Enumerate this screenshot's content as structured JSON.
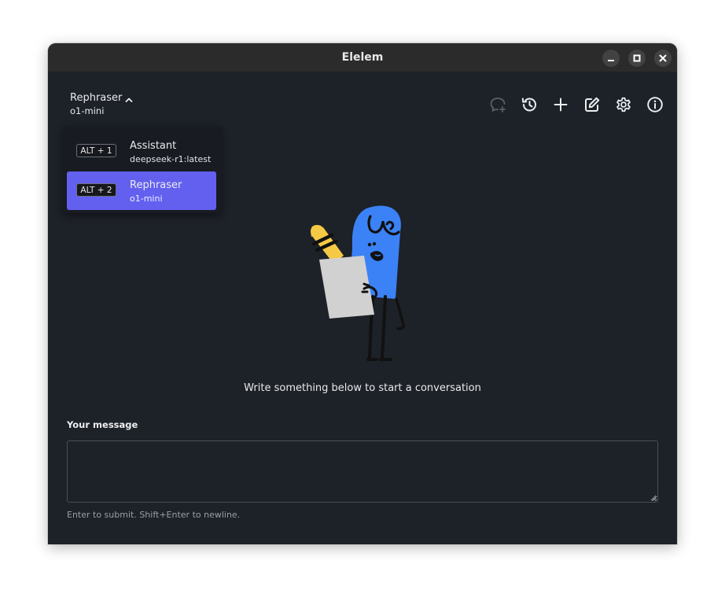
{
  "window": {
    "title": "Elelem"
  },
  "selector": {
    "name": "Rephraser",
    "model": "o1-mini"
  },
  "toolbar": {
    "icons": [
      "new-chat-icon",
      "history-icon",
      "plus-icon",
      "edit-icon",
      "gear-icon",
      "info-icon"
    ]
  },
  "dropdown": {
    "items": [
      {
        "shortcut": "ALT + 1",
        "label": "Assistant",
        "model": "deepseek-r1:latest",
        "active": false
      },
      {
        "shortcut": "ALT + 2",
        "label": "Rephraser",
        "model": "o1-mini",
        "active": true
      }
    ]
  },
  "empty_state": {
    "text": "Write something below to start a conversation"
  },
  "composer": {
    "label": "Your message",
    "value": "",
    "placeholder": "",
    "hint": "Enter to submit. Shift+Enter to newline."
  },
  "colors": {
    "background": "#1d2128",
    "accent": "#6360f0",
    "titlebar": "#2b2b2b"
  }
}
